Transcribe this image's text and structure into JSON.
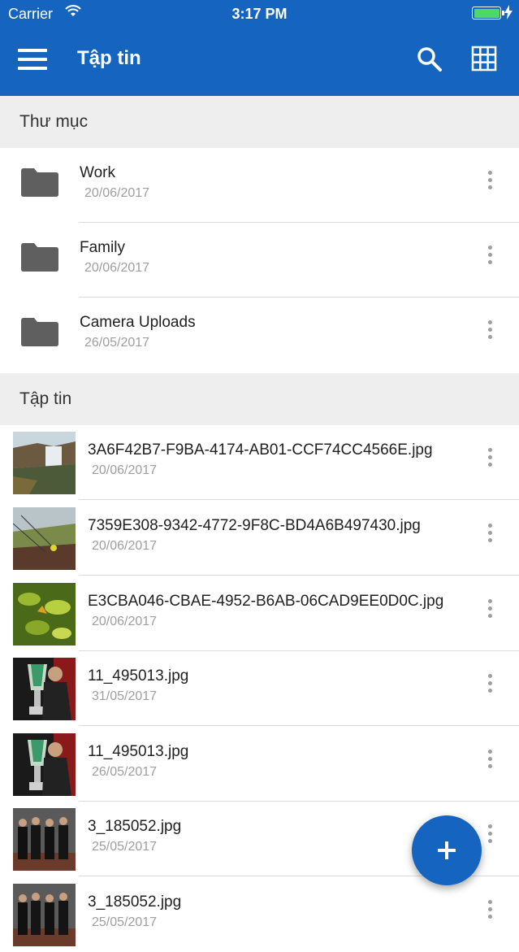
{
  "status_bar": {
    "carrier": "Carrier",
    "time": "3:17 PM"
  },
  "app_bar": {
    "title": "Tập tin",
    "icons": [
      "menu-icon",
      "search-icon",
      "grid-view-icon"
    ]
  },
  "folders_section": {
    "header": "Thư mục",
    "items": [
      {
        "name": "Work",
        "date": "20/06/2017"
      },
      {
        "name": "Family",
        "date": "20/06/2017"
      },
      {
        "name": "Camera Uploads",
        "date": "26/05/2017"
      }
    ]
  },
  "files_section": {
    "header": "Tập tin",
    "items": [
      {
        "name": "3A6F42B7-F9BA-4174-AB01-CCF74CC4566E.jpg",
        "date": "20/06/2017"
      },
      {
        "name": "7359E308-9342-4772-9F8C-BD4A6B497430.jpg",
        "date": "20/06/2017"
      },
      {
        "name": "E3CBA046-CBAE-4952-B6AB-06CAD9EE0D0C.jpg",
        "date": "20/06/2017"
      },
      {
        "name": "11_495013.jpg",
        "date": "31/05/2017"
      },
      {
        "name": "11_495013.jpg",
        "date": "26/05/2017"
      },
      {
        "name": "3_185052.jpg",
        "date": "25/05/2017"
      },
      {
        "name": "3_185052.jpg",
        "date": "25/05/2017"
      }
    ]
  },
  "fab": {
    "icon": "plus-icon"
  },
  "colors": {
    "primary": "#1565c0",
    "section_bg": "#eeeeee",
    "folder": "#5f5f5f",
    "secondary_text": "#9e9e9e"
  }
}
